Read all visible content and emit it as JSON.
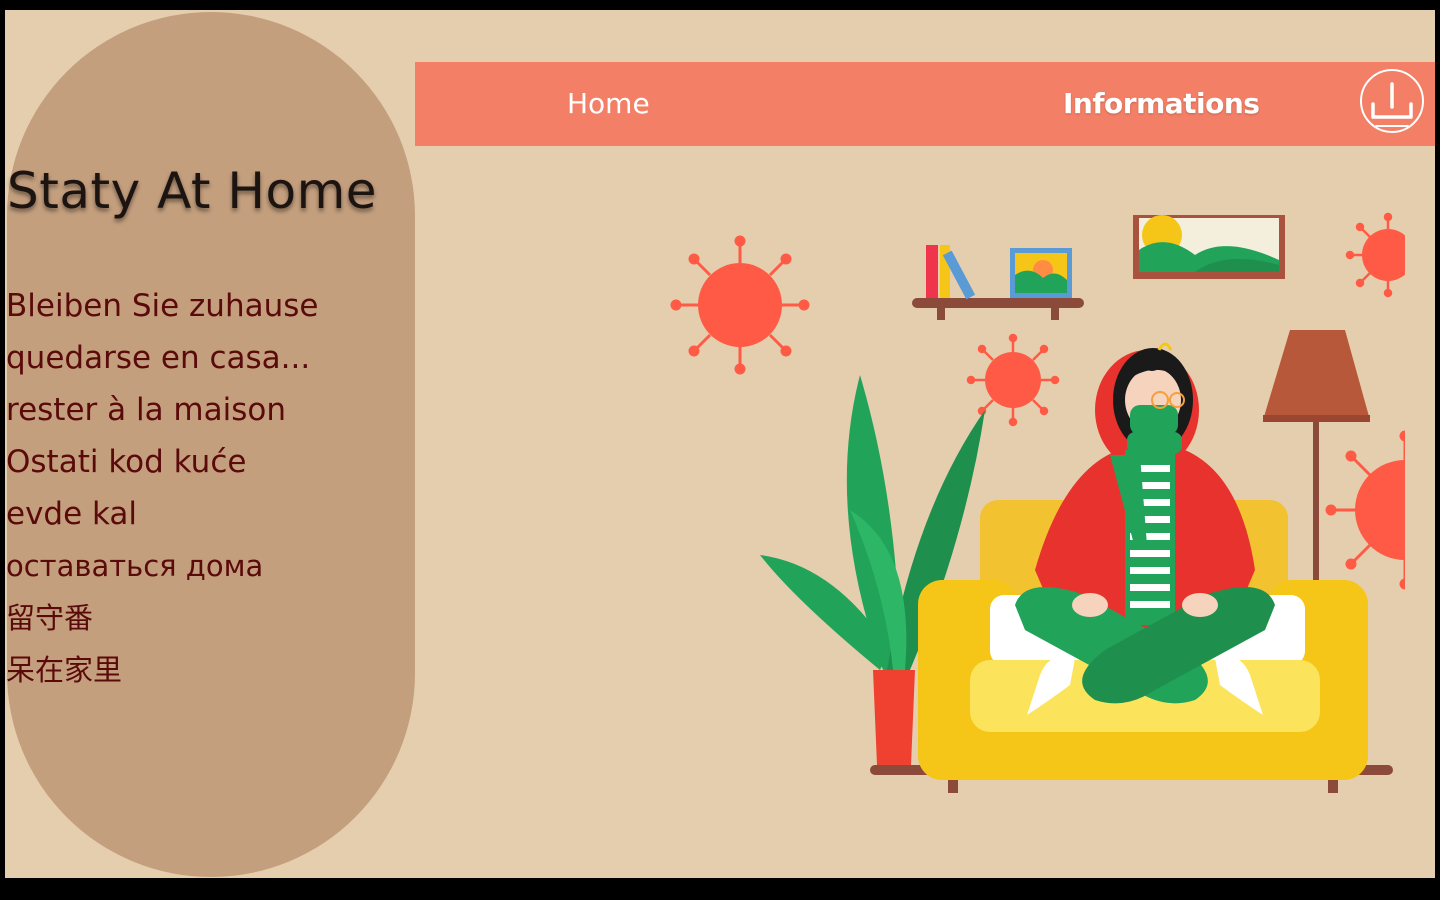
{
  "page": {
    "title": "Staty At Home"
  },
  "nav": {
    "home_label": "Home",
    "info_label": "Informations",
    "icon": "power-icon"
  },
  "phrases": [
    "Bleiben Sie zuhause",
    "quedarse en casa...",
    "rester à la maison",
    "Ostati kod kuće",
    "evde kal",
    "оставаться дома",
    "留守番",
    "呆在家里"
  ],
  "illustration": {
    "subject": "stay-at-home-illustration",
    "colors": {
      "accent": "#f37f66",
      "virus": "#ff5a45",
      "sofa": "#f5c518",
      "plant": "#21a35a",
      "background": "#e5cead",
      "sidebar": "#c49f7e"
    }
  }
}
